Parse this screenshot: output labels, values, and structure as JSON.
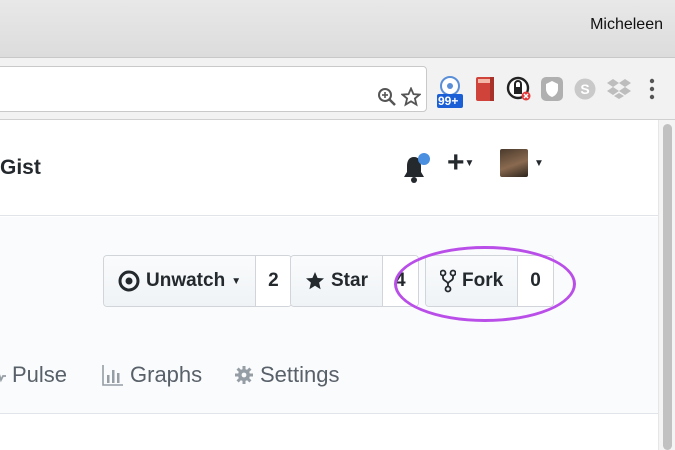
{
  "titlebar": {
    "profile_name": "Micheleen"
  },
  "toolbar": {
    "extensions": [
      {
        "icon": "extension-badge-icon",
        "badge": "99+"
      },
      {
        "icon": "red-book-extension-icon"
      },
      {
        "icon": "privacy-extension-icon"
      },
      {
        "icon": "shield-extension-icon"
      },
      {
        "icon": "skype-extension-icon"
      },
      {
        "icon": "dropbox-extension-icon"
      }
    ]
  },
  "header": {
    "brand": "Gist"
  },
  "repo_actions": {
    "watch": {
      "label": "Unwatch",
      "count": "2"
    },
    "star": {
      "label": "Star",
      "count": "4"
    },
    "fork": {
      "label": "Fork",
      "count": "0"
    }
  },
  "tabs": [
    {
      "label": "Pulse",
      "icon": "pulse-icon"
    },
    {
      "label": "Graphs",
      "icon": "graph-icon"
    },
    {
      "label": "Settings",
      "icon": "gear-icon"
    }
  ],
  "colors": {
    "annotation": "#b94fe8",
    "notification_dot": "#4a8fe0",
    "badge_blue": "#1a5fd6"
  }
}
